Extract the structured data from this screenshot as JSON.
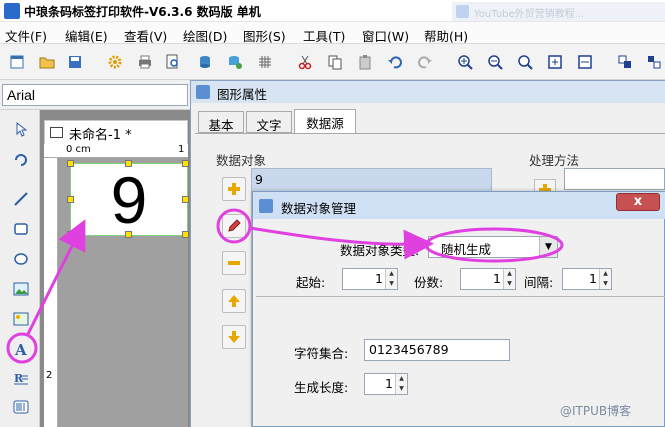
{
  "app": {
    "title": "中琅条码标签打印软件-V6.3.6 数码版 单机",
    "ghost_tab": "YouTube外贸营销教程..."
  },
  "menu": [
    "文件(F)",
    "编辑(E)",
    "查看(V)",
    "绘图(D)",
    "图形(S)",
    "工具(T)",
    "窗口(W)",
    "帮助(H)"
  ],
  "font": {
    "name": "Arial"
  },
  "document": {
    "tab_title": "未命名-1 *",
    "ruler_unit": "0 cm",
    "ruler_tick_1": "1",
    "ruler_tick_2": "2",
    "label_text": "9"
  },
  "props": {
    "title": "图形属性",
    "tabs": [
      "基本",
      "文字",
      "数据源"
    ],
    "data_object_label": "数据对象",
    "data_object_value": "9",
    "process_label": "处理方法"
  },
  "dialog": {
    "title": "数据对象管理",
    "close": "x",
    "type_label": "数据对象类型:",
    "type_value": "随机生成",
    "start_label": "起始:",
    "start_value": "1",
    "copies_label": "份数:",
    "copies_value": "1",
    "interval_label": "间隔:",
    "interval_value": "1",
    "charset_label": "字符集合:",
    "charset_value": "0123456789",
    "length_label": "生成长度:",
    "length_value": "1"
  },
  "watermark": "@ITPUB博客",
  "colors": {
    "annotation": "#e040e0",
    "selection_handle": "#ffe000",
    "title_bar": "#cfe0f5",
    "close_button": "#c75050"
  }
}
